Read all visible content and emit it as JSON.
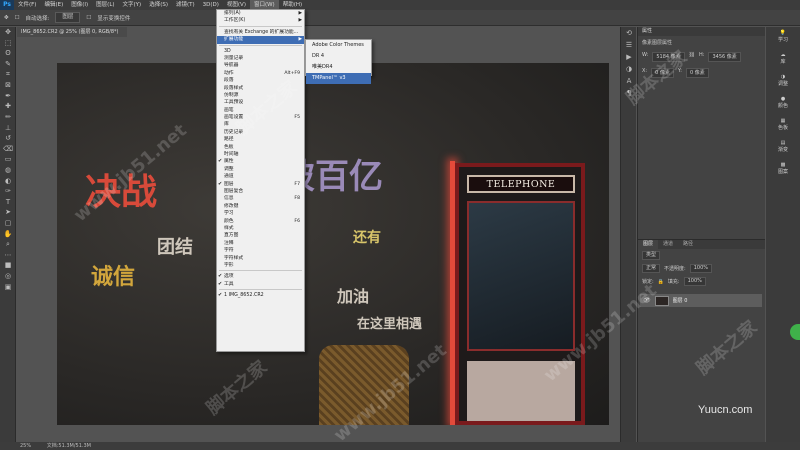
{
  "menubar": {
    "logo": "Ps",
    "items": [
      {
        "label": "文件(F)"
      },
      {
        "label": "编辑(E)"
      },
      {
        "label": "图像(I)"
      },
      {
        "label": "图层(L)"
      },
      {
        "label": "文字(Y)"
      },
      {
        "label": "选择(S)"
      },
      {
        "label": "滤镜(T)"
      },
      {
        "label": "3D(D)"
      },
      {
        "label": "视图(V)"
      },
      {
        "label": "窗口(W)"
      },
      {
        "label": "帮助(H)"
      }
    ],
    "active_index": 9
  },
  "optionsbar": {
    "autoselect_label": "自动选择:",
    "autoselect_value": "图层",
    "transform_label": "显示变换控件"
  },
  "document_tab": {
    "label": "IMG_8652.CR2 @ 25% (图层 0, RGB/8*)"
  },
  "window_menu": {
    "items": [
      {
        "label": "排列(A)",
        "arrow": "▶"
      },
      {
        "label": "工作区(K)",
        "arrow": "▶"
      },
      {
        "sep": true
      },
      {
        "label": "查找有关 Exchange 的扩展功能..."
      },
      {
        "label": "扩展功能",
        "arrow": "▶",
        "highlight": true
      },
      {
        "sep": true
      },
      {
        "label": "3D"
      },
      {
        "label": "测量记录"
      },
      {
        "label": "导航器"
      },
      {
        "label": "动作",
        "shortcut": "Alt+F9"
      },
      {
        "label": "段落"
      },
      {
        "label": "段落样式"
      },
      {
        "label": "仿制源"
      },
      {
        "label": "工具预设"
      },
      {
        "label": "画笔"
      },
      {
        "label": "画笔设置",
        "shortcut": "F5"
      },
      {
        "label": "库"
      },
      {
        "label": "历史记录"
      },
      {
        "label": "路径"
      },
      {
        "label": "色板"
      },
      {
        "label": "时间轴"
      },
      {
        "label": "属性",
        "check": "✔"
      },
      {
        "label": "调整"
      },
      {
        "label": "通道"
      },
      {
        "label": "图层",
        "shortcut": "F7",
        "check": "✔"
      },
      {
        "label": "图层复合"
      },
      {
        "label": "信息",
        "shortcut": "F8"
      },
      {
        "label": "修改键"
      },
      {
        "label": "学习"
      },
      {
        "label": "颜色",
        "shortcut": "F6"
      },
      {
        "label": "样式"
      },
      {
        "label": "直方图"
      },
      {
        "label": "注释"
      },
      {
        "label": "字符"
      },
      {
        "label": "字符样式"
      },
      {
        "label": "字形"
      },
      {
        "sep": true
      },
      {
        "label": "选项",
        "check": "✔"
      },
      {
        "label": "工具",
        "check": "✔"
      },
      {
        "sep": true
      },
      {
        "label": "1 IMG_8652.CR2",
        "check": "✔"
      }
    ]
  },
  "extensions_menu": {
    "items": [
      {
        "label": "Adobe Color Themes"
      },
      {
        "label": "DR 4"
      },
      {
        "label": "唯美DR4"
      },
      {
        "label": "TMPanel™ v3",
        "highlight": true
      }
    ]
  },
  "properties": {
    "title": "属性",
    "layer_kind": "像素图层属性",
    "w_label": "W:",
    "w_value": "5184 像素",
    "h_label": "H:",
    "h_value": "3456 像素",
    "x_label": "X:",
    "x_value": "0 像素",
    "y_label": "Y:",
    "y_value": "0 像素"
  },
  "layers_panel": {
    "tabs": [
      "图层",
      "通道",
      "路径"
    ],
    "kind_label": "类型",
    "blend_mode": "正常",
    "opacity_label": "不透明度:",
    "opacity_value": "100%",
    "lock_label": "锁定:",
    "fill_label": "填充:",
    "fill_value": "100%",
    "layer_name": "图层 0"
  },
  "right_panel": {
    "items": [
      "学习",
      "库",
      "调整",
      "颜色",
      "色板",
      "渐变",
      "图案"
    ]
  },
  "photo": {
    "booth_sign": "TELEPHONE",
    "chalk": [
      "决战",
      "势破百亿",
      "诚信",
      "团结",
      "加油",
      "在这里相遇",
      "还有"
    ]
  },
  "statusbar": {
    "zoom": "25%",
    "doc_info": "文档:51.3M/51.3M"
  },
  "watermarks": {
    "site_a": "www.jb51.net",
    "site_b": "脚本之家",
    "footer": "Yuucn.com"
  }
}
